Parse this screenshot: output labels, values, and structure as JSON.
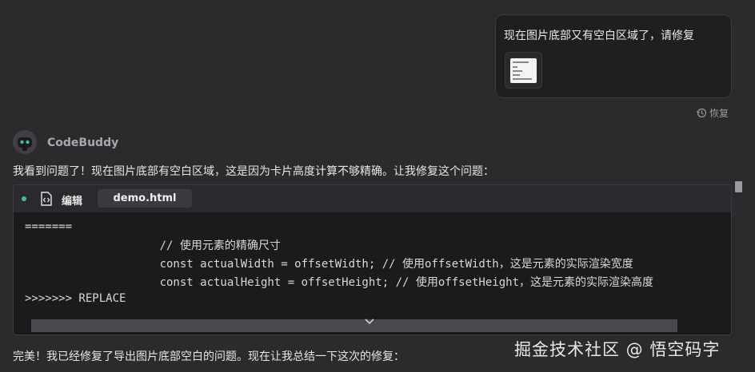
{
  "user_message": {
    "text": "现在图片底部又有空白区域了，请修复",
    "restore_label": "恢复"
  },
  "assistant": {
    "name": "CodeBuddy",
    "intro": "我看到问题了！现在图片底部有空白区域，这是因为卡片高度计算不够精确。让我修复这个问题：",
    "code_card": {
      "action_label": "编辑",
      "file_name": "demo.html",
      "lines": [
        "=======",
        "                    // 使用元素的精确尺寸",
        "                    const actualWidth = offsetWidth; // 使用offsetWidth，这是元素的实际渲染宽度",
        "                    const actualHeight = offsetHeight; // 使用offsetHeight，这是元素的实际渲染高度",
        ">>>>>>> REPLACE"
      ]
    },
    "outro": "完美！我已经修复了导出图片底部空白的问题。现在让我总结一下这次的修复："
  },
  "watermark": "掘金技术社区 @ 悟空码字",
  "colors": {
    "background": "#2b2b2e",
    "bubble": "#1f1f22",
    "code_bg": "#1b1b1e",
    "accent_dot": "#3fbfa0"
  }
}
